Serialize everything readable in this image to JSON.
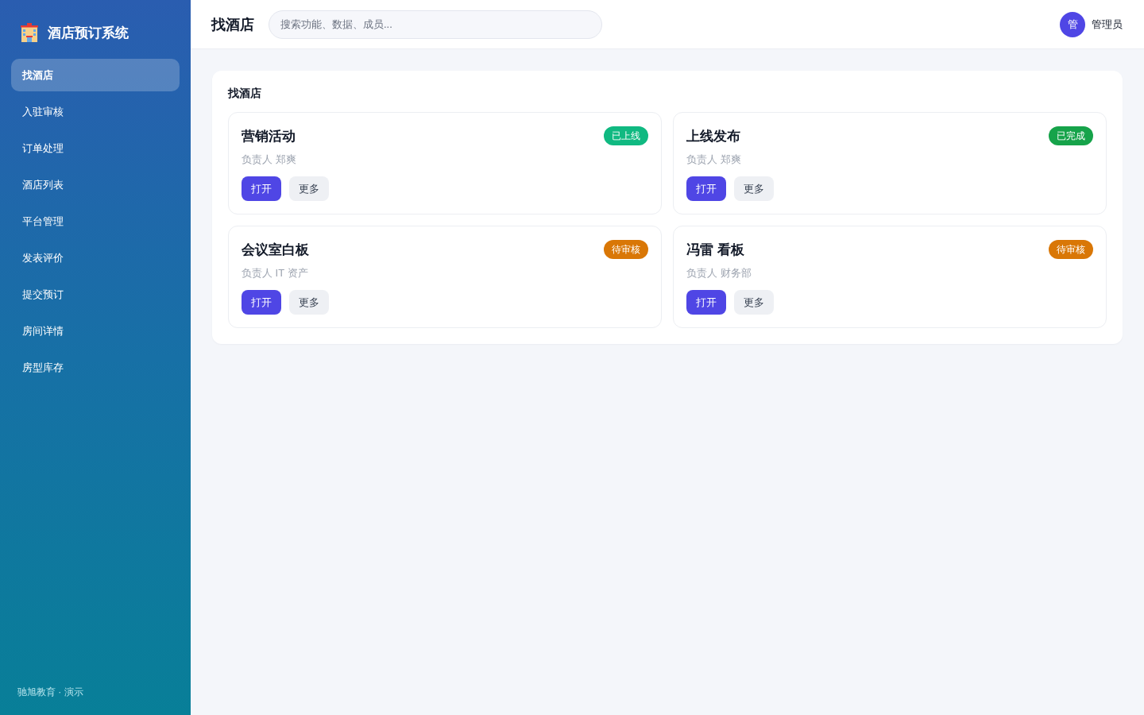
{
  "sidebar": {
    "brand": "酒店预订系统",
    "items": [
      {
        "label": "找酒店",
        "selected": true
      },
      {
        "label": "入驻审核",
        "selected": false
      },
      {
        "label": "订单处理",
        "selected": false
      },
      {
        "label": "酒店列表",
        "selected": false
      },
      {
        "label": "平台管理",
        "selected": false
      },
      {
        "label": "发表评价",
        "selected": false
      },
      {
        "label": "提交预订",
        "selected": false
      },
      {
        "label": "房间详情",
        "selected": false
      },
      {
        "label": "房型库存",
        "selected": false
      }
    ],
    "footer": "驰旭教育 · 演示"
  },
  "header": {
    "title": "找酒店",
    "search": {
      "placeholder": "搜索功能、数据、成员..."
    },
    "user": {
      "avatar": "管",
      "name": "管理员"
    }
  },
  "panel": {
    "title": "找酒店",
    "cards": [
      {
        "title": "营销活动",
        "badge": {
          "text": "已上线",
          "color": "#10b981"
        },
        "owner": "负责人 郑爽",
        "buttons": [
          {
            "label": "打开",
            "kind": "primary"
          },
          {
            "label": "更多",
            "kind": "secondary"
          }
        ]
      },
      {
        "title": "上线发布",
        "badge": {
          "text": "已完成",
          "color": "#16a34a"
        },
        "owner": "负责人 郑爽",
        "buttons": [
          {
            "label": "打开",
            "kind": "primary"
          },
          {
            "label": "更多",
            "kind": "secondary"
          }
        ]
      },
      {
        "title": "会议室白板",
        "badge": {
          "text": "待审核",
          "color": "#d97706"
        },
        "owner": "负责人 IT 资产",
        "buttons": [
          {
            "label": "打开",
            "kind": "primary"
          },
          {
            "label": "更多",
            "kind": "secondary"
          }
        ]
      },
      {
        "title": "冯雷 看板",
        "badge": {
          "text": "待审核",
          "color": "#d97706"
        },
        "owner": "负责人 财务部",
        "buttons": [
          {
            "label": "打开",
            "kind": "primary"
          },
          {
            "label": "更多",
            "kind": "secondary"
          }
        ]
      }
    ]
  }
}
